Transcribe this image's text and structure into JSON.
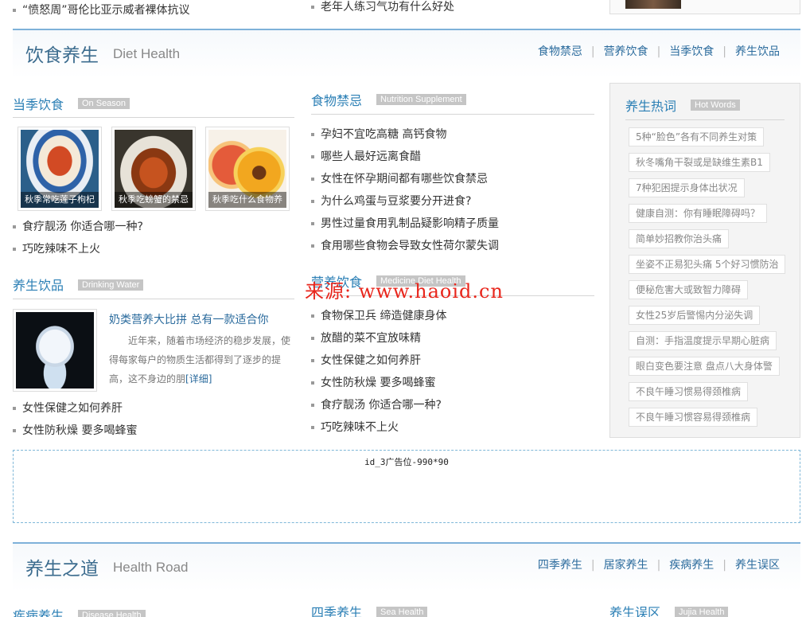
{
  "top": {
    "left_item": "“愤怒周”哥伦比亚示威者裸体抗议",
    "mid_item": "老年人练习气功有什么好处"
  },
  "diet": {
    "title": "饮食养生",
    "title_en": "Diet Health",
    "links": [
      "食物禁忌",
      "营养饮食",
      "当季饮食",
      "养生饮品"
    ]
  },
  "season": {
    "title": "当季饮食",
    "tag": "On Season",
    "thumbs": [
      {
        "caption": "秋季常吃莲子枸杞",
        "icon": "lotus-seed-soup-image"
      },
      {
        "caption": "秋季吃螃蟹的禁忌",
        "icon": "crab-image"
      },
      {
        "caption": "秋季吃什么食物养",
        "icon": "peach-image"
      }
    ],
    "items": [
      "食疗靓汤 你适合哪一种?",
      "巧吃辣味不上火"
    ]
  },
  "drink": {
    "title": "养生饮品",
    "tag": "Drinking Water",
    "feature_title": "奶类营养大比拼 总有一款适合你",
    "feature_desc": "近年来，随着市场经济的稳步发展，使得每家每户的物质生活都得到了逐步的提高，这不身边的朋",
    "more": "[详细]",
    "items": [
      "女性保健之如何养肝",
      "女性防秋燥 要多喝蜂蜜"
    ]
  },
  "taboo": {
    "title": "食物禁忌",
    "tag": "Nutrition Supplement",
    "items": [
      "孕妇不宜吃高糖 高钙食物",
      "哪些人最好远离食醋",
      "女性在怀孕期间都有哪些饮食禁忌",
      "为什么鸡蛋与豆浆要分开进食?",
      "男性过量食用乳制品疑影响精子质量",
      "食用哪些食物会导致女性荷尔蒙失调"
    ]
  },
  "nutrition": {
    "title": "营养饮食",
    "tag": "Medicine Diet Health",
    "items": [
      "食物保卫兵 缔造健康身体",
      "放醋的菜不宜放味精",
      "女性保健之如何养肝",
      "女性防秋燥 要多喝蜂蜜",
      "食疗靓汤 你适合哪一种?",
      "巧吃辣味不上火"
    ]
  },
  "watermark": "来源: www.haoid.cn",
  "hot": {
    "title": "养生热词",
    "tag": "Hot Words",
    "words": [
      "5种“脸色”各有不同养生对策",
      "秋冬嘴角干裂或是缺维生素B1",
      "7种犯困提示身体出状况",
      "健康自测：你有睡眠障碍吗？",
      "简单妙招教你治头痛",
      "坐姿不正易犯头痛 5个好习惯防治",
      "便秘危害大或致智力障碍",
      "女性25岁后警惕内分泌失调",
      "自测：手指温度提示早期心脏病",
      "眼白变色要注意 盘点八大身体警",
      "不良午睡习惯易得颈椎病",
      "不良午睡习惯容易得颈椎病"
    ]
  },
  "ad": {
    "text": "id_3广告位-990*90"
  },
  "road": {
    "title": "养生之道",
    "title_en": "Health Road",
    "links": [
      "四季养生",
      "居家养生",
      "疾病养生",
      "养生误区"
    ],
    "sub": [
      {
        "title": "疾病养生",
        "tag": "Disease Health"
      },
      {
        "title": "四季养生",
        "tag": "Sea Health"
      },
      {
        "title": "养生误区",
        "tag": "Jujia Health"
      }
    ]
  }
}
